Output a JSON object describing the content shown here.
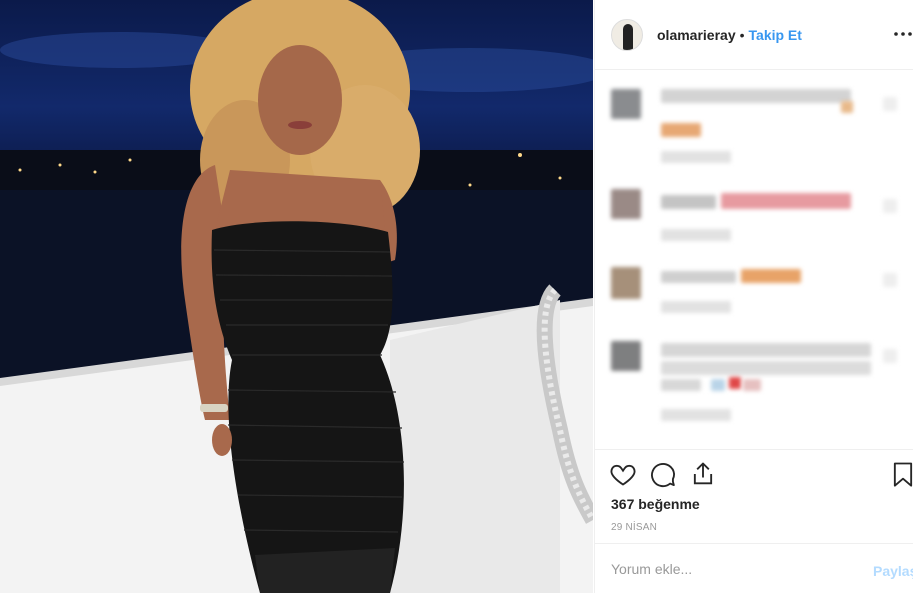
{
  "post": {
    "username": "olamarieray",
    "separator": "•",
    "follow_label": "Takip Et",
    "more_icon": "more-options-icon",
    "likes_text": "367 beğenme",
    "date_text": "29 NİSAN",
    "comment_placeholder": "Yorum ekle...",
    "share_label": "Paylaş"
  },
  "icons": {
    "like": "heart-icon",
    "comment": "speech-bubble-icon",
    "share": "share-upload-icon",
    "save": "bookmark-icon"
  },
  "colors": {
    "link": "#3897f0",
    "text": "#262626",
    "muted": "#999999",
    "share_disabled": "#b3dbff",
    "divider": "#efefef"
  }
}
